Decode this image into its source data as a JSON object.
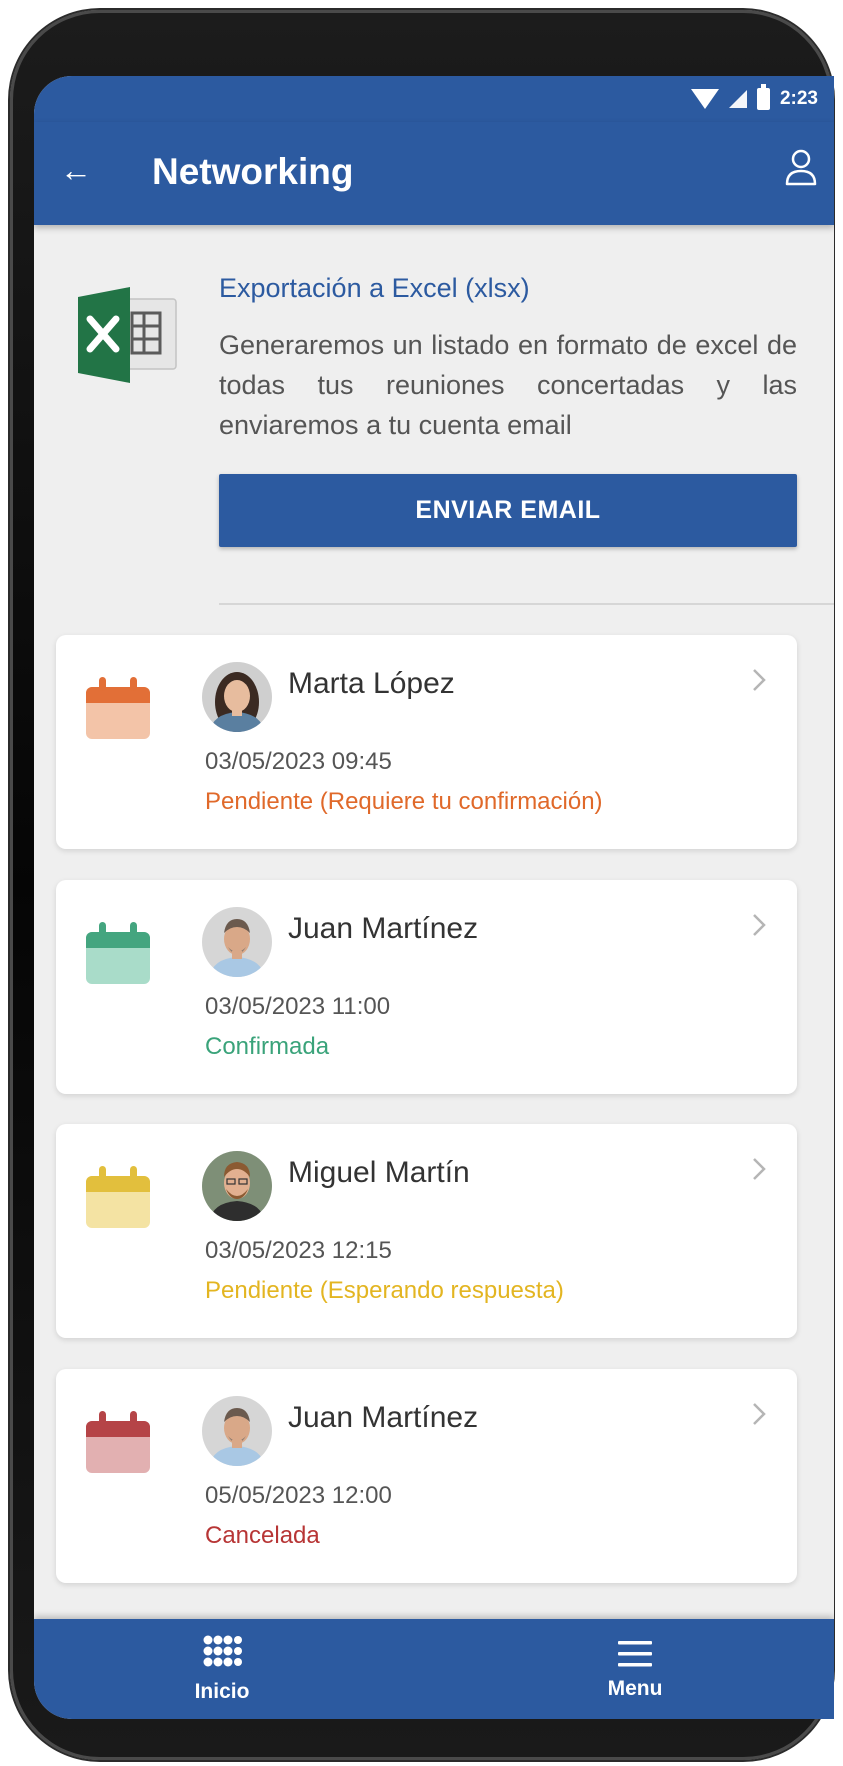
{
  "status_bar": {
    "time": "2:23"
  },
  "app_bar": {
    "back_icon": "←",
    "title": "Networking",
    "profile_icon": "person-icon"
  },
  "export": {
    "icon": "excel-icon",
    "title": "Exportación a Excel (xlsx)",
    "description": "Generaremos un listado en formato de excel de todas tus reuniones concertadas y las enviaremos a tu cuenta email",
    "button_label": "ENVIAR EMAIL"
  },
  "meetings": [
    {
      "name": "Marta López",
      "datetime": "03/05/2023 09:45",
      "status": "Pendiente (Requiere tu confirmación)",
      "status_color": "#e0692a",
      "icon_color": "#e26f37",
      "icon_light": "#f3c4a8"
    },
    {
      "name": "Juan Martínez",
      "datetime": "03/05/2023 11:00",
      "status": "Confirmada",
      "status_color": "#3aa37a",
      "icon_color": "#44a57f",
      "icon_light": "#a9dcc9"
    },
    {
      "name": "Miguel Martín",
      "datetime": "03/05/2023 12:15",
      "status": "Pendiente (Esperando respuesta)",
      "status_color": "#e3b521",
      "icon_color": "#e2bf3d",
      "icon_light": "#f4e3a3"
    },
    {
      "name": "Juan Martínez",
      "datetime": "05/05/2023 12:00",
      "status": "Cancelada",
      "status_color": "#b73535",
      "icon_color": "#b54447",
      "icon_light": "#e2b0b1"
    }
  ],
  "bottom_nav": {
    "items": [
      {
        "label": "Inicio",
        "icon": "grid-icon"
      },
      {
        "label": "Menu",
        "icon": "menu-icon"
      }
    ]
  },
  "colors": {
    "primary": "#2c5aa0",
    "background": "#efefef"
  }
}
